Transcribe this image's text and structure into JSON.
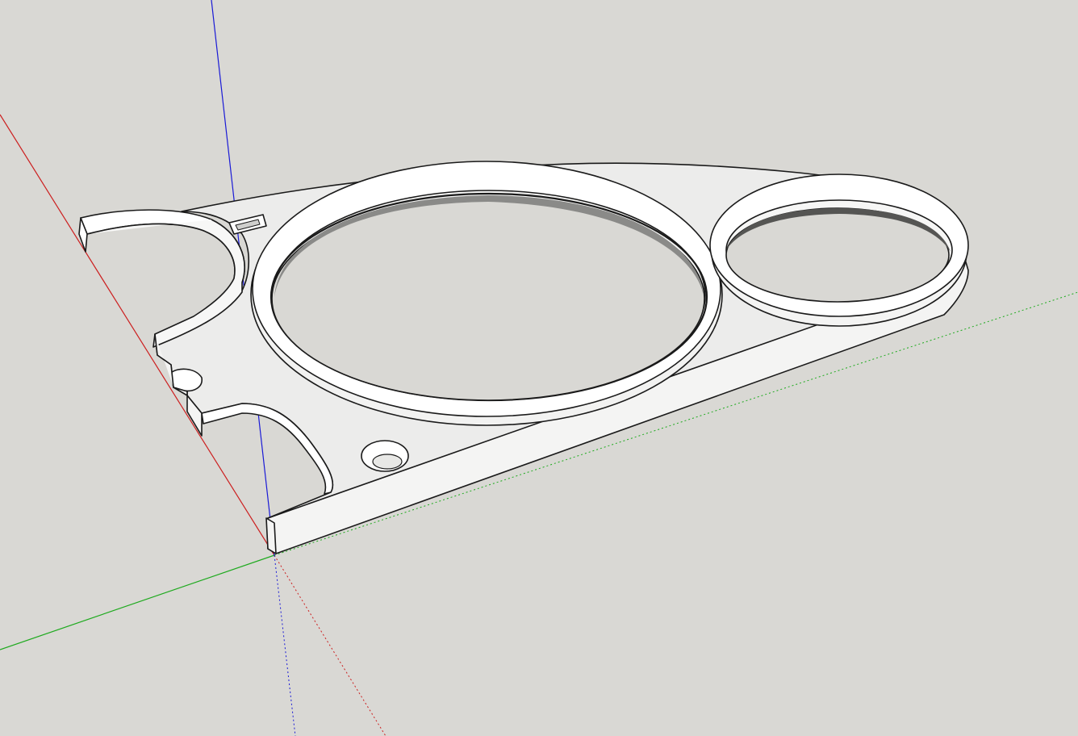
{
  "viewport": {
    "background_color": "#d9d8d4",
    "axis_colors": {
      "red": "#cc1f1f",
      "green": "#1faa1f",
      "blue": "#1a1ad6"
    },
    "model": {
      "face_color": "#ececeb",
      "highlight_color": "#ffffff",
      "edge_color": "#1a1a1a"
    }
  }
}
